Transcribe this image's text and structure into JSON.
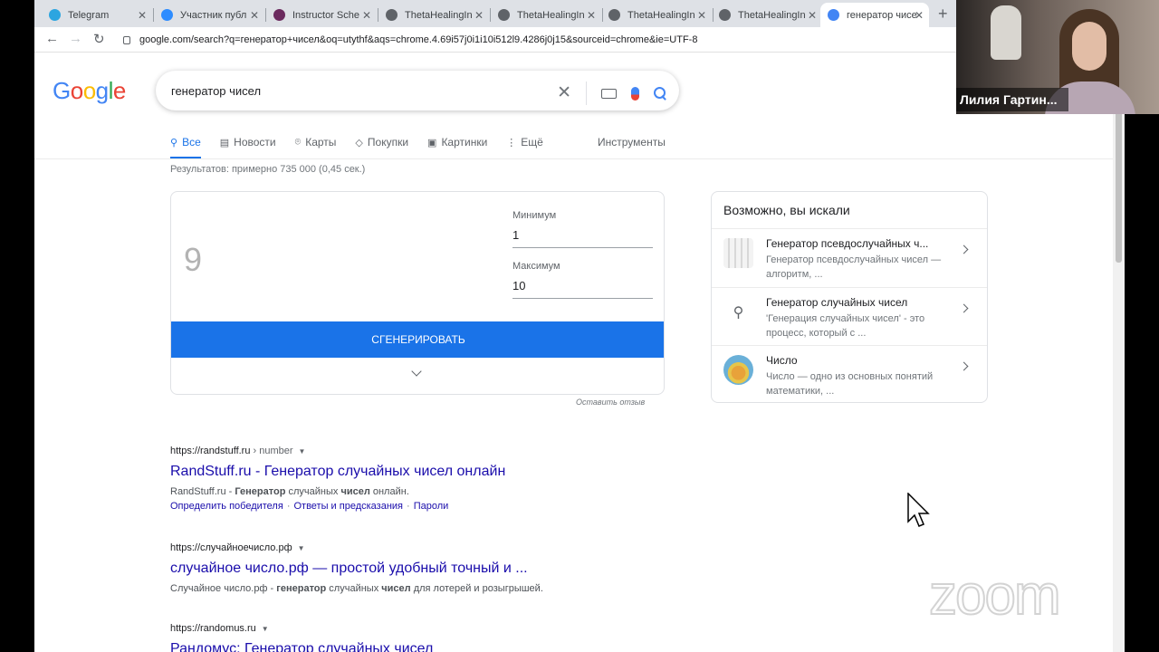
{
  "browser": {
    "tabs": [
      {
        "label": "Telegram",
        "color": "#2ca5e0"
      },
      {
        "label": "Участник публ",
        "color": "#2d8cff"
      },
      {
        "label": "Instructor Sche",
        "color": "#6b2a5e"
      },
      {
        "label": "ThetaHealingIn",
        "color": "#5f6368"
      },
      {
        "label": "ThetaHealingIn",
        "color": "#5f6368"
      },
      {
        "label": "ThetaHealingIn",
        "color": "#5f6368"
      },
      {
        "label": "ThetaHealingIn",
        "color": "#5f6368"
      },
      {
        "label": "генератор чисе",
        "color": "#4285f4"
      }
    ],
    "url": "google.com/search?q=генератор+чисел&oq=utythf&aqs=chrome.4.69i57j0i1i10i512l9.4286j0j15&sourceid=chrome&ie=UTF-8"
  },
  "search": {
    "logo": "Google",
    "query": "генератор чисел"
  },
  "nav": {
    "items": [
      "Все",
      "Новости",
      "Карты",
      "Покупки",
      "Картинки",
      "Ещё"
    ],
    "tools": "Инструменты"
  },
  "stats": "Результатов: примерно 735 000 (0,45 сек.)",
  "rng": {
    "result": "9",
    "min_label": "Минимум",
    "min_value": "1",
    "max_label": "Максимум",
    "max_value": "10",
    "button": "СГЕНЕРИРОВАТЬ",
    "feedback": "Оставить отзыв"
  },
  "related": {
    "title": "Возможно, вы искали",
    "items": [
      {
        "name": "Генератор псевдослучайных ч...",
        "desc": "Генератор псевдослучайных чисел — алгоритм, ..."
      },
      {
        "name": "Генератор случайных чисел",
        "desc": "'Генерация случайных чисел' - это процесс, который с ..."
      },
      {
        "name": "Число",
        "desc": "Число — одно из основных понятий математики, ..."
      }
    ]
  },
  "results": [
    {
      "url": "https://randstuff.ru",
      "crumb": " › number",
      "title": "RandStuff.ru - Генератор случайных чисел онлайн",
      "snippet_pre": "RandStuff.ru - ",
      "snippet_b1": "Генератор",
      "snippet_mid": " случайных ",
      "snippet_b2": "чисел",
      "snippet_post": " онлайн.",
      "links": [
        "Определить победителя",
        "Ответы и предсказания",
        "Пароли"
      ]
    },
    {
      "url": "https://случайноечисло.рф",
      "title": "случайное число.рф — простой удобный точный и ...",
      "snippet_pre": "Случайное число.рф - ",
      "snippet_b1": "генератор",
      "snippet_mid": " случайных ",
      "snippet_b2": "чисел",
      "snippet_post": " для лотерей и розыгрышей."
    },
    {
      "url": "https://randomus.ru",
      "title": "Рандомус: Генератор случайных чисел"
    }
  ],
  "zoom": {
    "participant_name": "Лилия Гартин...",
    "watermark": "zoom"
  }
}
